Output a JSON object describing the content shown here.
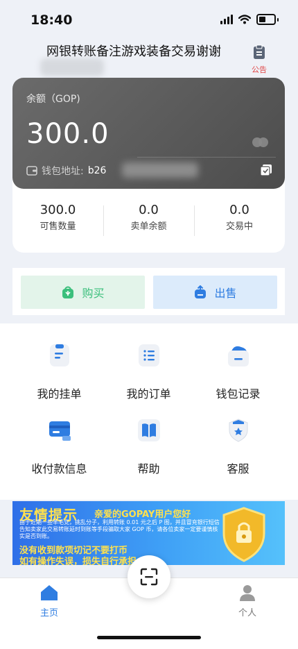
{
  "status_bar": {
    "time": "18:40"
  },
  "header": {
    "title": "网银转账备注游戏装备交易谢谢",
    "notice_label": "公告"
  },
  "balance": {
    "label": "余额（GOP)",
    "amount": "300.0",
    "wallet_label": "钱包地址:",
    "wallet_value": "b26"
  },
  "stats": [
    {
      "value": "300.0",
      "label": "可售数量"
    },
    {
      "value": "0.0",
      "label": "卖单余额"
    },
    {
      "value": "0.0",
      "label": "交易中"
    }
  ],
  "actions": {
    "buy": "购买",
    "sell": "出售"
  },
  "menu": [
    {
      "label": "我的挂单",
      "icon": "list-doc-icon"
    },
    {
      "label": "我的订单",
      "icon": "order-list-icon"
    },
    {
      "label": "钱包记录",
      "icon": "wallet-record-icon"
    },
    {
      "label": "收付款信息",
      "icon": "card-icon"
    },
    {
      "label": "帮助",
      "icon": "book-icon"
    },
    {
      "label": "客服",
      "icon": "customer-service-icon"
    }
  ],
  "banner": {
    "title": "友情提示",
    "subtitle": "亲爱的GOPAY用户您好",
    "body": "由于近期一些羊毛党，挑乱分子，利用转账 0.01 元之后 P 图，并且冒充银行短信告知卖家此交易转账延时到账等手段骗取大家 GOP 币，请各位卖家一定要谨慎核实是否到账。",
    "line1": "没有收到款项切记不要打币",
    "line2": "如有操作失误，损失自行承担"
  },
  "nav": {
    "home": "主页",
    "me": "个人"
  },
  "colors": {
    "accent": "#2f7de1",
    "buy": "#3bbf7c",
    "notice": "#e04646"
  }
}
